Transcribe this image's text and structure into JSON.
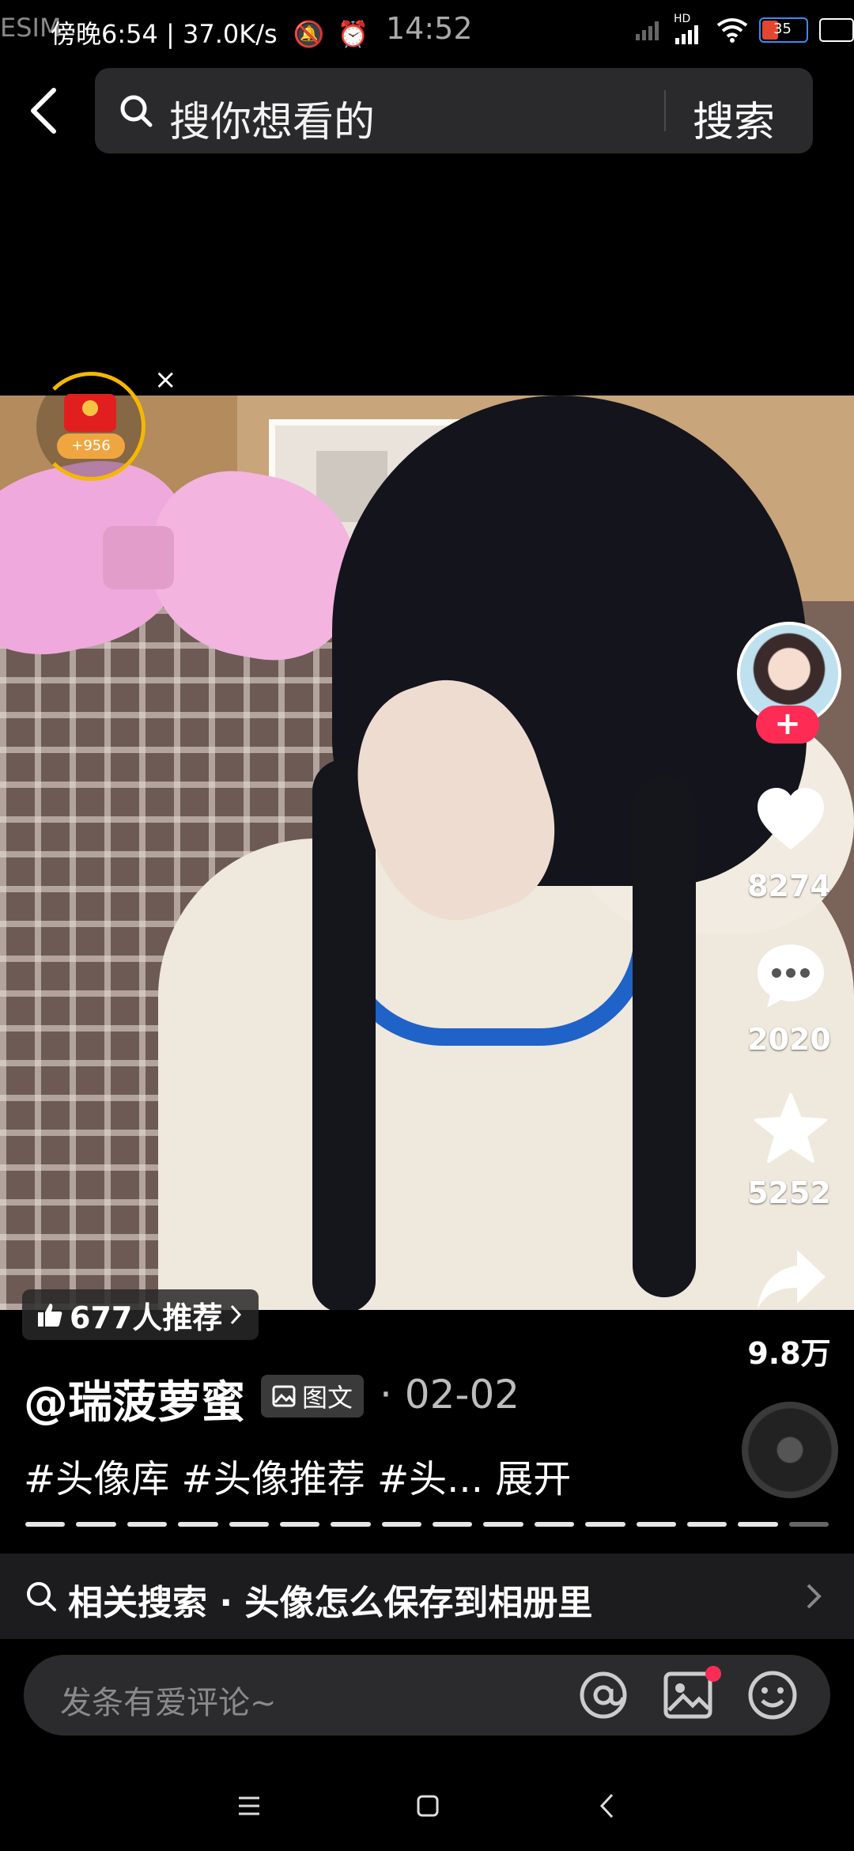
{
  "status_bar": {
    "left_text": "傍晚6:54 | 37.0K/s",
    "carrier_overlay": "ESIM",
    "clock": "14:52",
    "network_label": "HD",
    "battery_level": "35"
  },
  "search": {
    "placeholder": "搜你想看的",
    "button_label": "搜索"
  },
  "red_packet": {
    "amount": "+956",
    "close_label": "×"
  },
  "creator": {
    "follow_label": "+"
  },
  "actions": {
    "likes": "8274",
    "comments": "2020",
    "favorites": "5252",
    "shares": "9.8万"
  },
  "post": {
    "recommend_label": "677人推荐",
    "author": "@瑞菠萝蜜",
    "type_tag": "图文",
    "date": "· 02-02",
    "hashtags": "#头像库 #头像推荐 #头... 展开",
    "progress_total": 16,
    "progress_current": 15
  },
  "related_search": {
    "label": "相关搜索 · 头像怎么保存到相册里"
  },
  "comment_box": {
    "placeholder": "发条有爱评论~"
  },
  "colors": {
    "accent": "#fe2c55",
    "background": "#000000",
    "bar": "#2b2b2d"
  }
}
